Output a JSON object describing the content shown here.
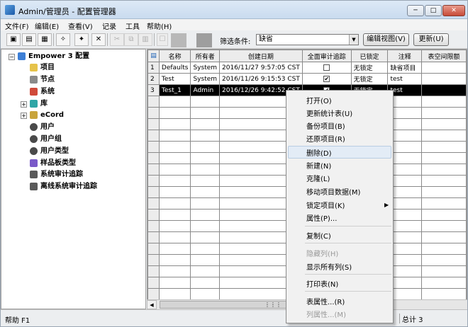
{
  "window": {
    "title": "Admin/管理员 - 配置管理器",
    "min": "─",
    "max": "□",
    "close": "✕"
  },
  "menu": [
    "文件(F)",
    "编辑(E)",
    "查看(V)",
    "记录",
    "工具",
    "帮助(H)"
  ],
  "toolbar": {
    "filter_label": "筛选条件:",
    "filter_value": "缺省",
    "edit_view": "编辑视图(V)",
    "update": "更新(U)"
  },
  "tree": {
    "root": "Empower 3 配置",
    "items": [
      "项目",
      "节点",
      "系统",
      "库",
      "eCord",
      "用户",
      "用户组",
      "用户类型",
      "样品板类型",
      "系统审计追踪",
      "离线系统审计追踪"
    ]
  },
  "grid": {
    "headers": [
      "名称",
      "所有者",
      "创建日期",
      "全面审计追踪",
      "已锁定",
      "注释",
      "表空间限额"
    ],
    "rows": [
      {
        "idx": "1",
        "name": "Defaults",
        "owner": "System",
        "date": "2016/11/27 9:57:05 CST",
        "audit": false,
        "locked": "无锁定",
        "comment": "缺省项目"
      },
      {
        "idx": "2",
        "name": "Test",
        "owner": "System",
        "date": "2016/11/26 9:15:53 CST",
        "audit": true,
        "locked": "无锁定",
        "comment": "test"
      },
      {
        "idx": "3",
        "name": "Test_1",
        "owner": "Admin",
        "date": "2016/12/26 9:42:52 CST",
        "audit": true,
        "locked": "无锁定",
        "comment": "test"
      }
    ]
  },
  "context_menu": [
    {
      "label": "打开(O)",
      "disabled": false
    },
    {
      "label": "更新统计表(U)",
      "disabled": false
    },
    {
      "label": "备份项目(B)",
      "disabled": false
    },
    {
      "label": "还原项目(R)",
      "disabled": false
    },
    {
      "label": "删除(D)",
      "disabled": false
    },
    {
      "label": "新建(N)",
      "disabled": false
    },
    {
      "label": "克隆(L)",
      "disabled": false
    },
    {
      "label": "移动项目数据(M)",
      "disabled": false
    },
    {
      "label": "锁定项目(K)",
      "disabled": false
    },
    {
      "label": "属性(P)...",
      "disabled": false
    },
    {
      "label": "复制(C)",
      "disabled": false
    },
    {
      "label": "隐藏列(H)",
      "disabled": true
    },
    {
      "label": "显示所有列(S)",
      "disabled": false
    },
    {
      "label": "打印表(N)",
      "disabled": false
    },
    {
      "label": "表属性...(R)",
      "disabled": false
    },
    {
      "label": "列属性...(M)",
      "disabled": true
    }
  ],
  "status": {
    "help": "帮助 F1",
    "total": "总计 3"
  },
  "colors": {
    "selection": "#000000",
    "hover": "#e3ecf6",
    "title_bg": "#dde9f6"
  }
}
